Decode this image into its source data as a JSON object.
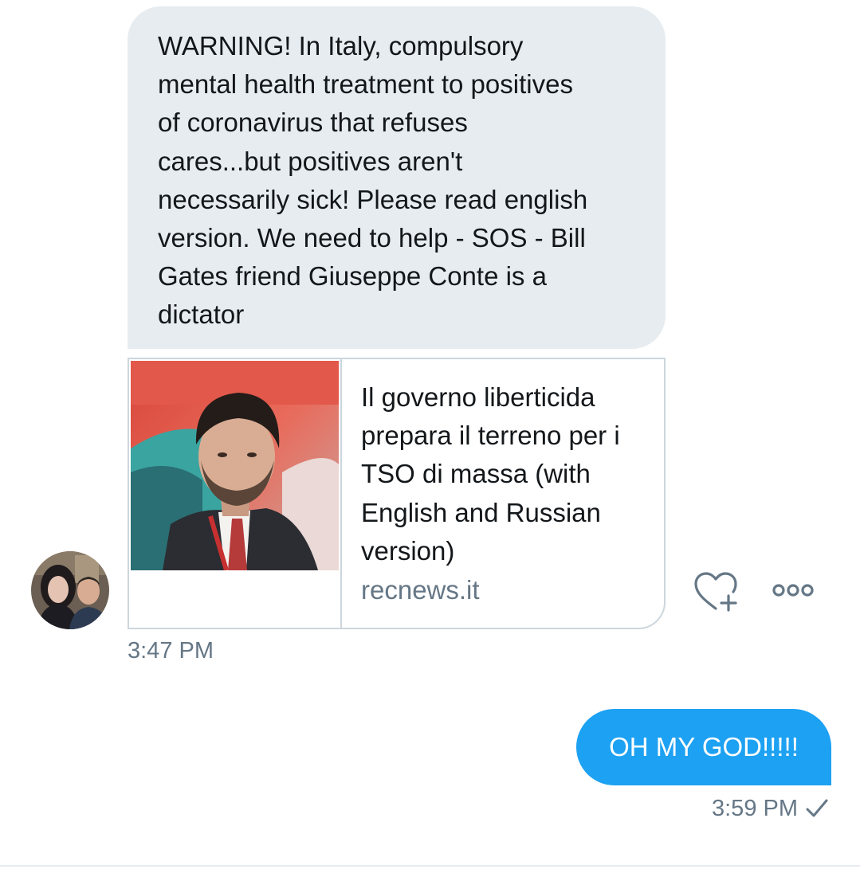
{
  "conversation": {
    "incoming": {
      "text": "WARNING! In Italy, compulsory mental health treatment to positives of coronavirus that refuses cares...but positives aren't necessarily sick! Please read english version. We need to help - SOS - Bill Gates friend Giuseppe Conte is a dictator",
      "lines": [
        "WARNING! In Italy, compulsory",
        "mental health treatment to positives",
        "of coronavirus that refuses",
        "cares...but positives aren't",
        "necessarily sick! Please read english",
        "version. We need to help - SOS - Bill",
        "Gates friend Giuseppe Conte is a",
        "dictator"
      ],
      "link_card": {
        "title_lines": [
          "Il governo liberticida",
          "prepara il terreno per i",
          "TSO di massa (with",
          "English and Russian",
          "version)"
        ],
        "domain": "recnews.it",
        "thumbnail": "portrait-photo"
      },
      "timestamp": "3:47 PM",
      "avatar": "profile-photo",
      "actions": {
        "like_icon": "heart-plus-icon",
        "more_icon": "more-options-icon"
      }
    },
    "outgoing": {
      "text": "OH MY GOD!!!!!",
      "timestamp": "3:59 PM",
      "status_icon": "checkmark-icon"
    }
  },
  "colors": {
    "incoming_bubble": "#e6ecf0",
    "outgoing_bubble": "#1da1f2",
    "text": "#14171a",
    "secondary_text": "#657786",
    "border": "#ccd6dd"
  }
}
